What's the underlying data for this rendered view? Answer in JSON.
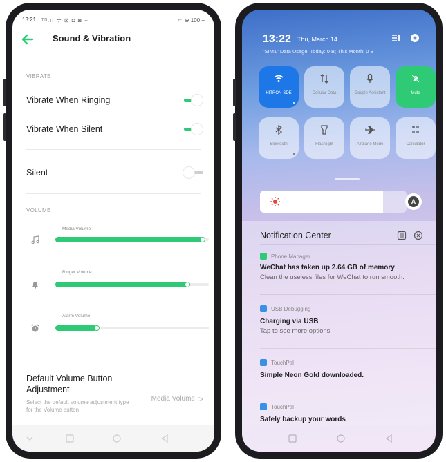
{
  "left_phone": {
    "status_bar": {
      "time": "13:21",
      "left_icons": "ᵀᴺ.ıl ᯤ ⊠ ◘ ◙ ⋯",
      "right_text": "⸦ ⊕ 100 +"
    },
    "header": {
      "title": "Sound & Vibration"
    },
    "vibrate": {
      "section_label": "VIBRATE",
      "when_ringing": {
        "label": "Vibrate When Ringing",
        "enabled": true
      },
      "when_silent": {
        "label": "Vibrate When Silent",
        "enabled": true
      }
    },
    "silent": {
      "label": "Silent",
      "enabled": false
    },
    "volume": {
      "section_label": "VOLUME",
      "sliders": [
        {
          "label": "Media Volume",
          "icon": "music-note-icon",
          "level": 0.96
        },
        {
          "label": "Ringer Volume",
          "icon": "bell-icon",
          "level": 0.86
        },
        {
          "label": "Alarm Volume",
          "icon": "alarm-clock-icon",
          "level": 0.27
        }
      ]
    },
    "default_volume_button": {
      "title": "Default Volume Button Adjustment",
      "description": "Select the default volume adjustment type for the Volume button",
      "value": "Media Volume",
      "chevron": ">"
    },
    "accent_color": "#2fca76"
  },
  "right_phone": {
    "time": "13:22",
    "date": "Thu, March 14",
    "data_usage": "\"SIM1\" Data Usage, Today: 0 B; This Month: 0 B",
    "tiles": [
      {
        "label": "HITRON-SDE",
        "icon": "wifi-icon",
        "state": "on"
      },
      {
        "label": "Cellular Data",
        "icon": "cellular-data-icon",
        "state": "off"
      },
      {
        "label": "Google Assistant",
        "icon": "microphone-icon",
        "state": "off"
      },
      {
        "label": "Mute",
        "icon": "mute-bell-icon",
        "state": "on"
      },
      {
        "label": "Bluetooth",
        "icon": "bluetooth-icon",
        "state": "off"
      },
      {
        "label": "Flashlight",
        "icon": "flashlight-icon",
        "state": "off"
      },
      {
        "label": "Airplane Mode",
        "icon": "airplane-icon",
        "state": "off"
      },
      {
        "label": "Calculator",
        "icon": "calculator-icon",
        "state": "off"
      }
    ],
    "brightness": {
      "level": 0.84,
      "auto_label": "A"
    },
    "notification_center": {
      "title": "Notification Center",
      "notifications": [
        {
          "app": "Phone Manager",
          "app_color": "#2fca76",
          "title": "WeChat has taken up 2.64 GB of memory",
          "body": "Clean the useless files for WeChat to run smooth."
        },
        {
          "app": "USB Debugging",
          "app_color": "#3a8fe6",
          "title": "Charging via USB",
          "body": "Tap to see more options"
        },
        {
          "app": "TouchPal",
          "app_color": "#3a8fe6",
          "title": "Simple Neon Gold downloaded.",
          "body": ""
        },
        {
          "app": "TouchPal",
          "app_color": "#3a8fe6",
          "title": "Safely backup your words",
          "body": ""
        }
      ]
    }
  }
}
